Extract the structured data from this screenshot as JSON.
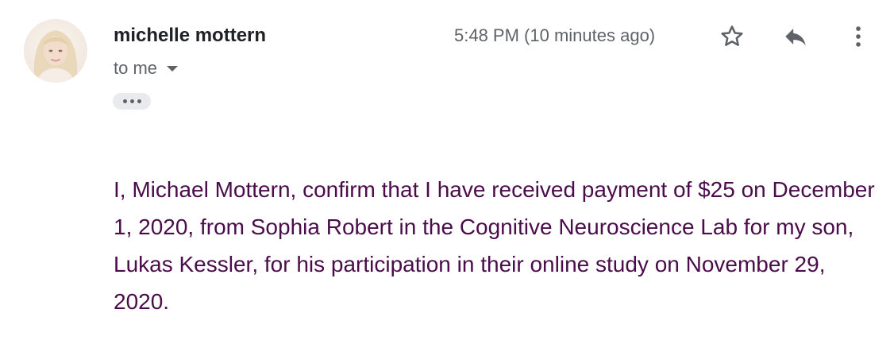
{
  "message": {
    "sender": {
      "name": "michelle mottern",
      "avatar_icon": "user-photo-avatar"
    },
    "recipient_label": "to me",
    "timestamp": "5:48 PM (10 minutes ago)",
    "actions": {
      "star_icon": "star-outline-icon",
      "reply_icon": "reply-arrow-icon",
      "more_icon": "more-vertical-icon"
    },
    "trimmed_content_icon": "ellipsis-icon",
    "body": "I, Michael Mottern, confirm that I have received payment of $25 on December 1, 2020, from Sophia Robert in the Cognitive Neuroscience Lab for my son, Lukas Kessler, for his participation in their online study on November 29, 2020."
  },
  "colors": {
    "sender_name": "#202124",
    "secondary_text": "#5f6368",
    "body_text": "#4a0c4a",
    "pill_background": "#e8eaed"
  }
}
